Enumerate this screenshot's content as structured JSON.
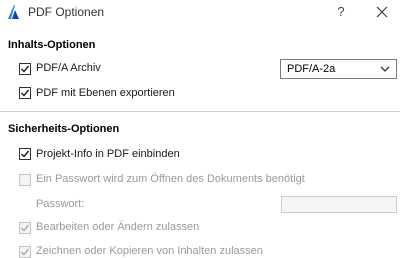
{
  "window": {
    "title": "PDF Optionen",
    "help_glyph": "?"
  },
  "content_options": {
    "heading": "Inhalts-Optionen",
    "pdfa_archive": {
      "label": "PDF/A Archiv",
      "checked": true
    },
    "pdfa_select": {
      "value": "PDF/A-2a"
    },
    "export_layers": {
      "label": "PDF mit Ebenen exportieren",
      "checked": true
    }
  },
  "security_options": {
    "heading": "Sicherheits-Optionen",
    "project_info": {
      "label": "Projekt-Info in PDF einbinden",
      "checked": true
    },
    "open_password": {
      "label": "Ein Passwort wird zum Öffnen des Dokuments benötigt",
      "checked": false,
      "disabled": true
    },
    "password": {
      "label": "Passwort:",
      "value": ""
    },
    "edit_allowed": {
      "label": "Bearbeiten oder Ändern zulassen",
      "checked": true,
      "disabled": true
    },
    "copy_allowed": {
      "label": "Zeichnen oder Kopieren von Inhalten zulassen",
      "checked": true,
      "disabled": true
    }
  },
  "colors": {
    "accent": "#1e88e5",
    "text": "#1a1a1a",
    "disabled_text": "#9a9a9a"
  }
}
